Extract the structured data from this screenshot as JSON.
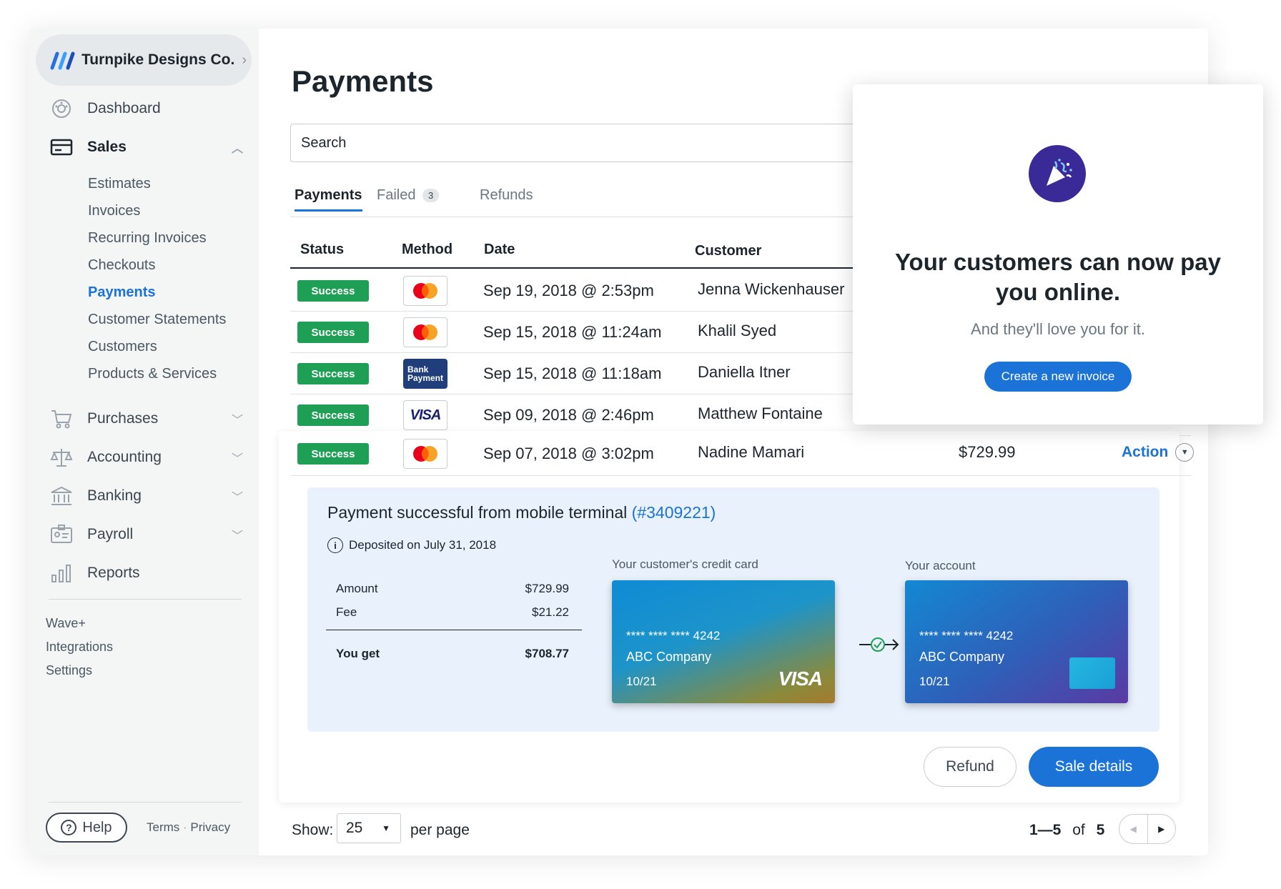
{
  "business": {
    "name": "Turnpike Designs Co."
  },
  "sidebar": {
    "items": [
      {
        "label": "Dashboard",
        "icon": "dashboard-icon"
      },
      {
        "label": "Sales",
        "icon": "sales-icon"
      },
      {
        "label": "Purchases",
        "icon": "cart-icon"
      },
      {
        "label": "Accounting",
        "icon": "scale-icon"
      },
      {
        "label": "Banking",
        "icon": "bank-icon"
      },
      {
        "label": "Payroll",
        "icon": "payroll-icon"
      },
      {
        "label": "Reports",
        "icon": "reports-icon"
      }
    ],
    "sales_sub": [
      "Estimates",
      "Invoices",
      "Recurring Invoices",
      "Checkouts",
      "Payments",
      "Customer Statements",
      "Customers",
      "Products & Services"
    ],
    "extra": [
      "Wave+",
      "Integrations",
      "Settings"
    ],
    "help": "Help",
    "terms": "Terms",
    "privacy": "Privacy"
  },
  "page": {
    "title": "Payments"
  },
  "search": {
    "value": "Search"
  },
  "tabs": [
    {
      "label": "Payments"
    },
    {
      "label": "Failed",
      "count": "3"
    },
    {
      "label": "Refunds"
    }
  ],
  "table": {
    "headers": [
      "Status",
      "Method",
      "Date",
      "Customer"
    ],
    "rows": [
      {
        "status": "Success",
        "method": "mastercard",
        "date": "Sep 19, 2018 @ 2:53pm",
        "customer": "Jenna Wickenhauser"
      },
      {
        "status": "Success",
        "method": "mastercard",
        "date": "Sep 15, 2018 @ 11:24am",
        "customer": "Khalil Syed"
      },
      {
        "status": "Success",
        "method": "bank",
        "date": "Sep 15, 2018 @ 11:18am",
        "customer": "Daniella Itner"
      },
      {
        "status": "Success",
        "method": "visa",
        "date": "Sep 09, 2018 @ 2:46pm",
        "customer": "Matthew Fontaine"
      },
      {
        "status": "Success",
        "method": "mastercard",
        "date": "Sep 07, 2018 @ 3:02pm",
        "customer": "Nadine Mamari",
        "amount": "$729.99",
        "action": "Action"
      }
    ],
    "bank_label_1": "Bank",
    "bank_label_2": "Payment",
    "visa_label": "VISA"
  },
  "detail": {
    "title": "Payment successful from mobile terminal",
    "ref": "(#3409221)",
    "deposited": "Deposited on July 31, 2018",
    "amount_label": "Amount",
    "amount": "$729.99",
    "fee_label": "Fee",
    "fee": "$21.22",
    "you_get_label": "You get",
    "you_get": "$708.77",
    "customer_card_label": "Your customer's credit card",
    "account_label": "Your account",
    "card_number": "**** **** **** 4242",
    "card_company": "ABC Company",
    "card_expiry": "10/21",
    "card_brand": "VISA"
  },
  "buttons": {
    "refund": "Refund",
    "sale_details": "Sale details"
  },
  "footer": {
    "show": "Show:",
    "per_page_value": "25",
    "per_page": "per page",
    "range": "1—5",
    "of": "of",
    "total": "5"
  },
  "popup": {
    "headline": "Your customers can now pay you online.",
    "sub": "And they'll love you for it.",
    "cta": "Create a new invoice"
  },
  "colors": {
    "primary": "#1b73d8",
    "success": "#1f9e55",
    "popup_icon_bg": "#3a2a98"
  }
}
